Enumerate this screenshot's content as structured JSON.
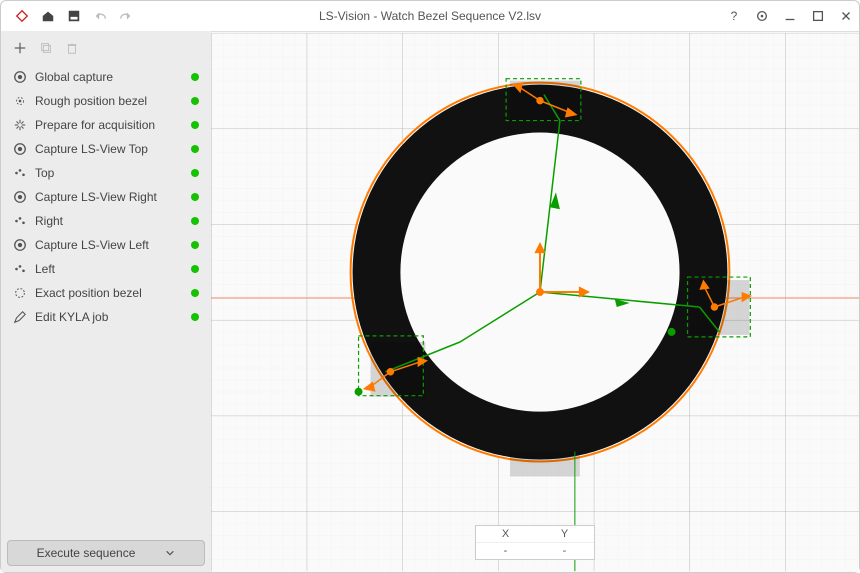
{
  "window": {
    "title": "LS-Vision - Watch Bezel Sequence V2.lsv"
  },
  "sidebar": {
    "steps": [
      {
        "icon": "camera",
        "label": "Global capture"
      },
      {
        "icon": "target",
        "label": "Rough position bezel"
      },
      {
        "icon": "spark",
        "label": "Prepare for acquisition"
      },
      {
        "icon": "camera",
        "label": "Capture LS-View Top"
      },
      {
        "icon": "dotset",
        "label": "Top"
      },
      {
        "icon": "camera",
        "label": "Capture LS-View Right"
      },
      {
        "icon": "dotset",
        "label": "Right"
      },
      {
        "icon": "camera",
        "label": "Capture LS-View Left"
      },
      {
        "icon": "dotset",
        "label": "Left"
      },
      {
        "icon": "circle",
        "label": "Exact position bezel"
      },
      {
        "icon": "pencil",
        "label": "Edit KYLA job"
      }
    ],
    "execute_label": "Execute sequence"
  },
  "coord": {
    "x_label": "X",
    "y_label": "Y",
    "x_value": "-",
    "y_value": "-"
  }
}
